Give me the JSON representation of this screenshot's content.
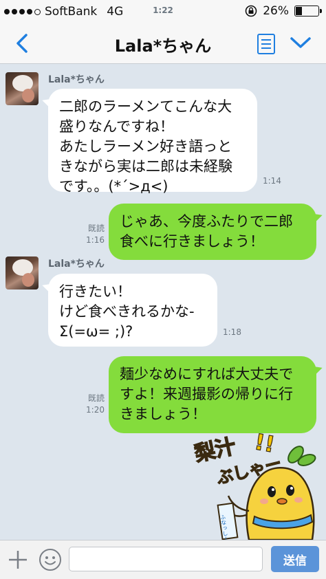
{
  "status_bar": {
    "carrier": "SoftBank",
    "network": "4G",
    "time": "1:22",
    "battery_percent": "26%",
    "battery_level": 0.26,
    "signal_bars": 4
  },
  "header": {
    "title": "Lala*ちゃん"
  },
  "messages": [
    {
      "sender": "Lala*ちゃん",
      "text": "二郎のラーメンてこんな大\n盛りなんですね！\nあたしラーメン好き語っと\nきながら実は二郎は未経験\nです。。(*´>д<)",
      "time": "1:14"
    },
    {
      "text": "じゃあ、今度ふたりで二郎\n食べに行きましょう！",
      "read": "既読",
      "time": "1:16"
    },
    {
      "sender": "Lala*ちゃん",
      "text": "行きたい！\nけど食べきれるかな-\nΣ(=ω= ;)?",
      "time": "1:18"
    },
    {
      "text": "麺少なめにすれば大丈夫で\nすよ！来週撮影の帰りに行\nきましょう！",
      "read": "既読",
      "time": "1:20"
    }
  ],
  "sticker": {
    "text_top": "梨汁",
    "text_bottom": "ぶしゃー",
    "exclaim": "!!",
    "sign_text": "ふなっしー"
  },
  "input_bar": {
    "placeholder": "",
    "send_label": "送信"
  },
  "colors": {
    "chat_background": "#dde5ed",
    "outgoing_bubble": "#84dc3c",
    "incoming_bubble": "#ffffff",
    "accent": "#1f7fe0",
    "send_button": "#5b94d9"
  }
}
